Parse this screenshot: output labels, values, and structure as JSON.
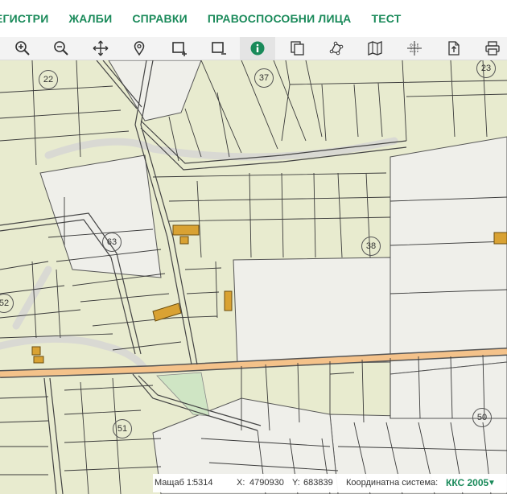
{
  "menu": {
    "items": [
      "ЕГИСТРИ",
      "ЖАЛБИ",
      "СПРАВКИ",
      "ПРАВОСПОСОБНИ ЛИЦА",
      "ТЕСТ"
    ]
  },
  "toolbar": {
    "tools": [
      {
        "icon": "zoom-in-icon",
        "active": false
      },
      {
        "icon": "zoom-out-icon",
        "active": false
      },
      {
        "icon": "pan-icon",
        "active": false
      },
      {
        "icon": "location-pin-icon",
        "active": false
      },
      {
        "icon": "select-rectangle-add-icon",
        "active": false
      },
      {
        "icon": "select-rectangle-remove-icon",
        "active": false
      },
      {
        "icon": "info-icon",
        "active": true
      },
      {
        "icon": "document-layers-icon",
        "active": false
      },
      {
        "icon": "measure-polygon-icon",
        "active": false
      },
      {
        "icon": "map-icon",
        "active": false
      },
      {
        "icon": "coordinates-icon",
        "active": false
      },
      {
        "icon": "export-icon",
        "active": false
      },
      {
        "icon": "print-icon",
        "active": false
      }
    ]
  },
  "map": {
    "parcel_numbers": [
      "22",
      "37",
      "23",
      "63",
      "38",
      "52",
      "51",
      "50"
    ],
    "colors": {
      "parcel_fill": "#e8ebcf",
      "road": "#f4c28a",
      "building": "#d9a233",
      "green_area": "#cfe5c4",
      "boundary": "#333333"
    }
  },
  "status": {
    "scale_label": "Мащаб 1:",
    "scale_value": "5314",
    "x_label": "X:",
    "x_value": "4790930",
    "y_label": "Y:",
    "y_value": "683839",
    "crs_label": "Координатна система:",
    "crs_value": "ККС 2005"
  }
}
